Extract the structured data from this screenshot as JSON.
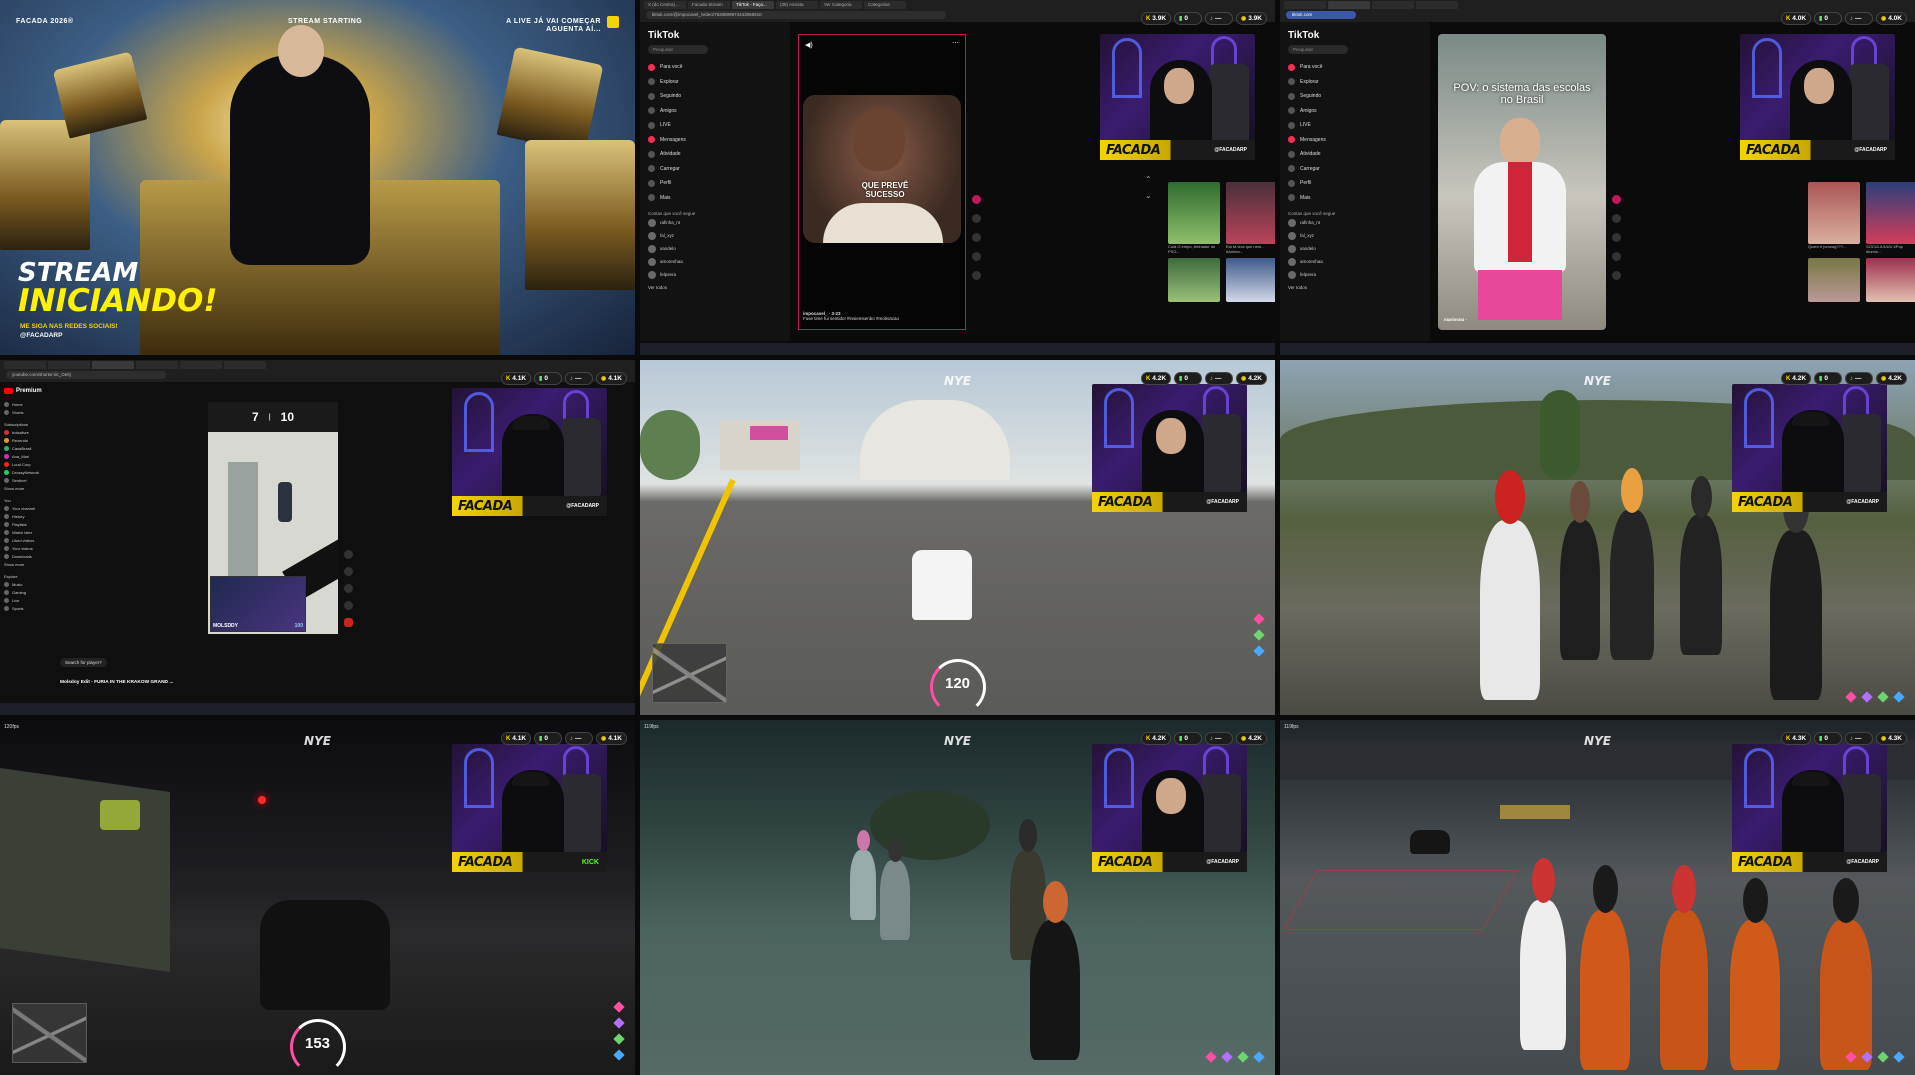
{
  "tile1": {
    "top_left": "FACADA 2026®",
    "top_center": "STREAM STARTING",
    "top_right_1": "A LIVE JÁ VAI COMEÇAR",
    "top_right_2": "AGUENTA AÍ...",
    "headline_1": "STREAM",
    "headline_2": "INICIANDO!",
    "sub_1": "ME SIGA NAS REDES SOCIAIS!",
    "sub_2": "@FACADARP"
  },
  "tile2": {
    "tabs": [
      "X (do Centra)...",
      "Facada Stream",
      "TikTok - Faça...",
      "(39) Assista",
      "Ver Categoria",
      "Categorias"
    ],
    "url": "tiktok.com/@impocavel_/video/7620809974443066510",
    "logo": "TikTok",
    "search_placeholder": "Pesquisar",
    "nav": [
      "Para você",
      "Explorar",
      "Seguindo",
      "Amigos",
      "LIVE",
      "Mensagens",
      "Atividade",
      "Carregar",
      "Perfil",
      "Mais"
    ],
    "following_label": "Contas que você segue",
    "accounts": [
      "rafinha_nt",
      "fal_xyz",
      "xandelo",
      "amorenhaa",
      "felpsera",
      "Ver todos"
    ],
    "video_caption_user": "impocavel_ · 3-23",
    "video_caption_text": "Fuse time fui sentido! #insiemsenbo #motivacao",
    "video_overlay": "QUE PREVÊ SUCESSO",
    "thumb_captions": [
      "Cuiá O empo, treinador do PSG...",
      "Ela tá viva que nem... #Anima..."
    ],
    "pills": [
      "3.9K",
      "0",
      "—",
      "3.9K"
    ]
  },
  "tile3": {
    "url": "tiktok.com",
    "logo": "TikTok",
    "search_placeholder": "Pesquisar",
    "nav": [
      "Para você",
      "Explorar",
      "Seguindo",
      "Amigos",
      "LIVE",
      "Mensagens",
      "Atividade",
      "Carregar",
      "Perfil",
      "Mais"
    ],
    "following_label": "Contas que você segue",
    "accounts": [
      "rafinha_nt",
      "fal_xyz",
      "xandelo",
      "amorenhaa",
      "felpsera",
      "Ver todos"
    ],
    "video_title": "POV: o sistema das escolas no Brasil",
    "video_caption_user": "mariosou ·",
    "thumb_captions": [
      "Quem é jornzag???...",
      "SOCULIUUUU #Pop #turnlu..."
    ],
    "pills": [
      "4.0K",
      "0",
      "—",
      "4.0K"
    ]
  },
  "tile4": {
    "url": "youtube.com/shorts/-dc_Oe0j",
    "yt_label": "Premium",
    "side_items": [
      "Home",
      "Shorts",
      "Subscriptions",
      "bolsalivre",
      "Rezendo",
      "CasaBrasil",
      "Ana_Mari",
      "Loud Corp",
      "DrossyNetwork",
      "Sentinel",
      "Show more",
      "You",
      "Your channel",
      "History",
      "Playlists",
      "Watch later",
      "Liked videos",
      "Your videos",
      "Downloads",
      "Show more",
      "Explore",
      "Music",
      "Gaming",
      "Live",
      "Sports"
    ],
    "scoreboard_left": "7",
    "scoreboard_right": "10",
    "player_name": "MOLSDDY",
    "player_score": "100",
    "search_hint": "Search for player?",
    "video_title": "Molsdoy Edit - FURIA IN THE KRAKOW GRAND ...",
    "pills": [
      "4.1K",
      "0",
      "—",
      "4.1K"
    ]
  },
  "tile5": {
    "watermark": "NYE",
    "speed": "120",
    "pills": [
      "4.2K",
      "0",
      "—",
      "4.2K"
    ]
  },
  "tile6": {
    "watermark": "NYE",
    "pills": [
      "4.2K",
      "0",
      "—",
      "4.2K"
    ]
  },
  "tile7": {
    "fps": "120fps",
    "watermark": "NYE",
    "speed": "153",
    "pills": [
      "4.1K",
      "0",
      "—",
      "4.1K"
    ],
    "kick_label": "KICK"
  },
  "tile8": {
    "fps": "119fps",
    "watermark": "NYE",
    "pills": [
      "4.2K",
      "0",
      "—",
      "4.2K"
    ]
  },
  "tile9": {
    "fps": "119fps",
    "watermark": "NYE",
    "pills": [
      "4.3K",
      "0",
      "—",
      "4.3K"
    ]
  },
  "cam": {
    "brand": "FACADA",
    "handle": "@FACADARP"
  },
  "colors": {
    "brand_yellow": "#f4d300",
    "tiktok_pink": "#fe2c55",
    "youtube_red": "#ff0000"
  }
}
